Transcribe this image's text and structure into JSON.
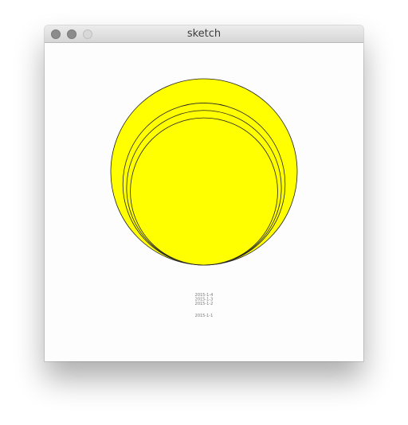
{
  "window": {
    "title": "sketch"
  },
  "chart_data": {
    "type": "bubble",
    "fill_color": "#ffff00",
    "stroke_color": "#222222",
    "points": [
      {
        "label": "2015-1-1",
        "value": 1.0
      },
      {
        "label": "2015-1-2",
        "value": 0.87
      },
      {
        "label": "2015-1-3",
        "value": 0.83
      },
      {
        "label": "2015-1-4",
        "value": 0.79
      }
    ]
  }
}
